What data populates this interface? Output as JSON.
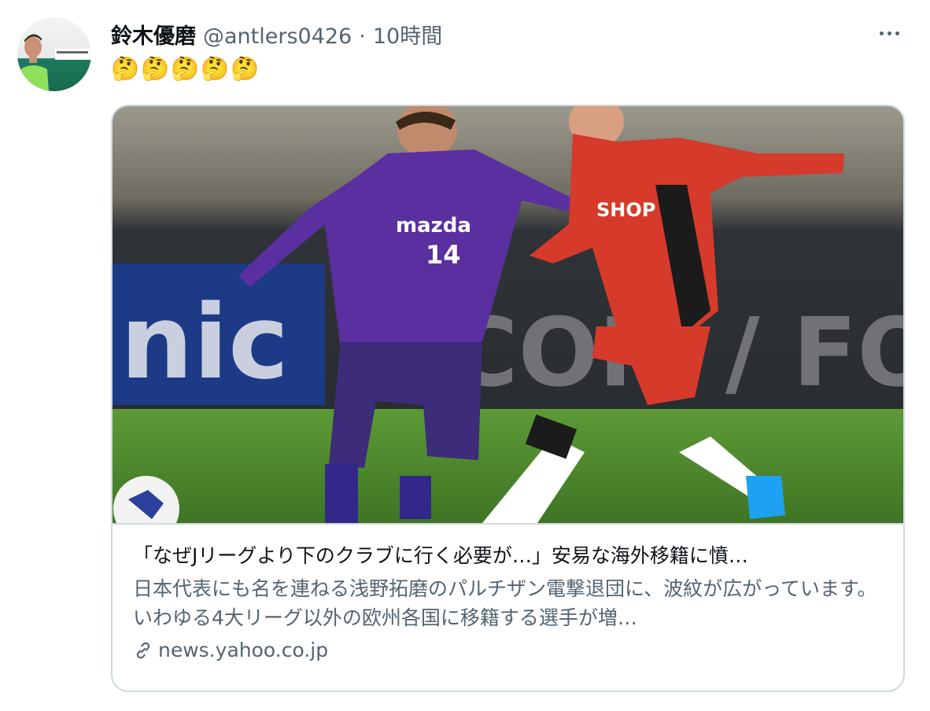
{
  "tweet": {
    "author_name": "鈴木優磨",
    "handle": "@antlers0426",
    "separator": "·",
    "time": "10時間",
    "text": "🤔🤔🤔🤔🤔",
    "more_icon": "more-horizontal-icon"
  },
  "card": {
    "title": "「なぜJリーグより下のクラブに行く必要が…」安易な海外移籍に憤…",
    "description": "日本代表にも名を連ねる浅野拓磨のパルチザン電撃退団に、波紋が広がっています。いわゆる4大リーグ以外の欧州各国に移籍する選手が増…",
    "domain": "news.yahoo.co.jp",
    "link_icon": "link-icon"
  },
  "colors": {
    "text_primary": "#0f1419",
    "text_secondary": "#536471",
    "border": "#cfd9de",
    "purple_kit": "#4b2a8c",
    "red_kit": "#d63a2a",
    "pitch": "#4f8a2c"
  }
}
